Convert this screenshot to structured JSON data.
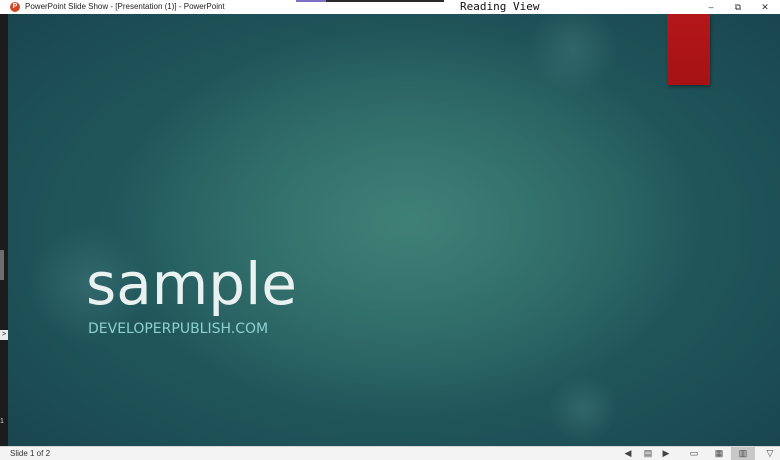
{
  "window": {
    "title": "PowerPoint Slide Show - [Presentation (1)] - PowerPoint",
    "app_icon_letter": "P",
    "overlay_label": "Reading View",
    "controls": {
      "minimize": "–",
      "maximize": "⧉",
      "close": "✕"
    }
  },
  "left_edge": {
    "arrow_glyph": ">",
    "mark_glyph": "1"
  },
  "slide": {
    "title": "sample",
    "subtitle": "DEVELOPERPUBLISH.COM",
    "colors": {
      "background_center": "#3f8076",
      "background_edge": "#173f4b",
      "title": "#eaf2f1",
      "subtitle": "#8fd0d1",
      "accent_tab": "#b4171a"
    }
  },
  "status_bar": {
    "slide_counter": "Slide 1 of 2",
    "nav": {
      "previous_icon": "previous-icon",
      "previous_glyph": "◀",
      "menu_icon": "slide-menu-icon",
      "menu_glyph": "▤",
      "next_icon": "next-icon",
      "next_glyph": "▶"
    },
    "views": {
      "normal_icon": "normal-view-icon",
      "normal_glyph": "▭",
      "sorter_icon": "slide-sorter-icon",
      "sorter_glyph": "▦",
      "reading_icon": "reading-view-icon",
      "reading_glyph": "▥",
      "slideshow_icon": "slide-show-icon",
      "slideshow_glyph": "▽",
      "active": "reading"
    }
  }
}
